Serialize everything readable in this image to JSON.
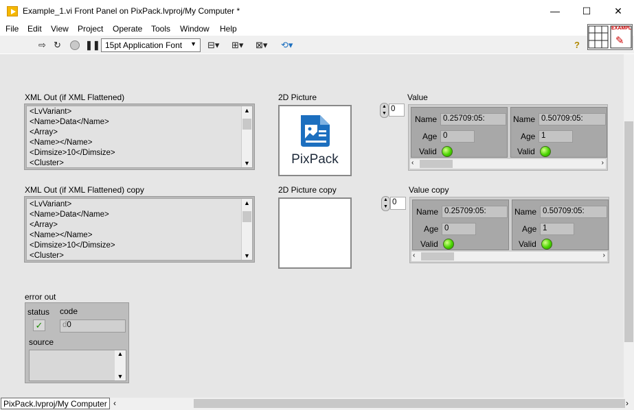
{
  "window": {
    "title": "Example_1.vi Front Panel on PixPack.lvproj/My Computer *",
    "controls": {
      "minimize": "—",
      "maximize": "☐",
      "close": "✕"
    }
  },
  "menu": [
    "File",
    "Edit",
    "View",
    "Project",
    "Operate",
    "Tools",
    "Window",
    "Help"
  ],
  "toolbar": {
    "font_select": "15pt Application Font",
    "vi_icon_text": "EXAMPL",
    "icons": [
      "run-arrow-icon",
      "run-continuous-icon",
      "abort-icon",
      "pause-icon",
      "align-icon",
      "distribute-icon",
      "resize-icon",
      "reorder-icon",
      "help-icon"
    ]
  },
  "panel": {
    "xml_out": {
      "label": "XML Out (if XML Flattened)",
      "lines": [
        "<LvVariant>",
        "<Name>Data</Name>",
        "<Array>",
        "<Name></Name>",
        "<Dimsize>10</Dimsize>",
        "<Cluster>"
      ]
    },
    "xml_out_copy": {
      "label": "XML Out (if XML Flattened) copy",
      "lines": [
        "<LvVariant>",
        "<Name>Data</Name>",
        "<Array>",
        "<Name></Name>",
        "<Dimsize>10</Dimsize>",
        "<Cluster>"
      ]
    },
    "picture": {
      "label": "2D Picture",
      "logo_text": "PixPack"
    },
    "picture_copy": {
      "label": "2D Picture copy"
    },
    "value": {
      "label": "Value",
      "index": "0",
      "elements": [
        {
          "name_label": "Name",
          "name_value": "0.25709:05:",
          "age_label": "Age",
          "age_value": "0",
          "valid_label": "Valid"
        },
        {
          "name_label": "Name",
          "name_value": "0.50709:05:",
          "age_label": "Age",
          "age_value": "1",
          "valid_label": "Valid"
        }
      ]
    },
    "value_copy": {
      "label": "Value copy",
      "index": "0",
      "elements": [
        {
          "name_label": "Name",
          "name_value": "0.25709:05:",
          "age_label": "Age",
          "age_value": "0",
          "valid_label": "Valid"
        },
        {
          "name_label": "Name",
          "name_value": "0.50709:05:",
          "age_label": "Age",
          "age_value": "1",
          "valid_label": "Valid"
        }
      ]
    },
    "error_out": {
      "label": "error out",
      "status_label": "status",
      "code_label": "code",
      "code_prefix": "d",
      "code_value": "0",
      "source_label": "source",
      "source_value": ""
    }
  },
  "statusbar": {
    "context": "PixPack.lvproj/My Computer"
  }
}
